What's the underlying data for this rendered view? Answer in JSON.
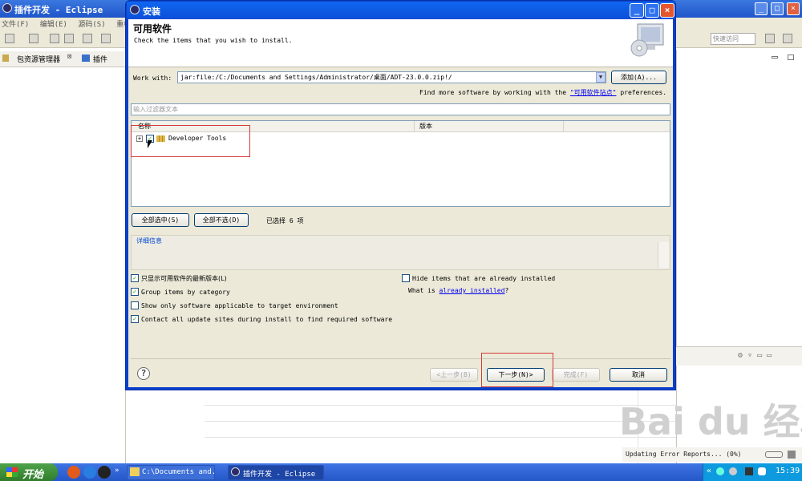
{
  "eclipse": {
    "title": "插件开发 - Eclipse",
    "menu": [
      "文件(F)",
      "编辑(E)",
      "源码(S)",
      "重构(T)"
    ],
    "left_tabs": [
      "包资源管理器",
      "插件"
    ],
    "quick_access": "快速访问"
  },
  "dialog": {
    "title": "安装",
    "heading": "可用软件",
    "description": "Check the items that you wish to install.",
    "work_with_label": "Work with:",
    "work_with_value": "jar:file:/C:/Documents and Settings/Administrator/桌面/ADT-23.0.0.zip!/",
    "add_button": "添加(A)...",
    "find_more_prefix": "Find more software by working with the",
    "find_more_link": "\"可用软件站点\"",
    "find_more_suffix": "preferences.",
    "filter_placeholder": "输入过滤器文本",
    "table": {
      "columns": [
        "名称",
        "版本"
      ],
      "rows": [
        {
          "name": "Developer Tools",
          "version": "",
          "checked": true
        }
      ]
    },
    "select_all": "全部选中(S)",
    "deselect_all": "全部不选(D)",
    "selected_count": "已选择 6 项",
    "details_label": "详细信息",
    "options": [
      {
        "label": "只显示可用软件的最新版本(L)",
        "checked": true
      },
      {
        "label": "Group items by category",
        "checked": true
      },
      {
        "label": "Show only software applicable to target environment",
        "checked": false
      },
      {
        "label": "Contact all update sites during install to find required software",
        "checked": true
      }
    ],
    "hide_installed": {
      "label": "Hide items that are already installed",
      "checked": false
    },
    "what_is_prefix": "What is",
    "what_is_link": "already installed",
    "what_is_suffix": "?",
    "back": "<上一步(B)",
    "next": "下一步(N)>",
    "finish": "完成(F)",
    "cancel": "取消"
  },
  "status_bar": {
    "text": "Updating Error Reports... (0%)"
  },
  "watermark": "Bai du 经验",
  "taskbar": {
    "start": "开始",
    "items": [
      "C:\\Documents and...",
      "插件开发 - Eclipse"
    ],
    "time": "15:39"
  }
}
